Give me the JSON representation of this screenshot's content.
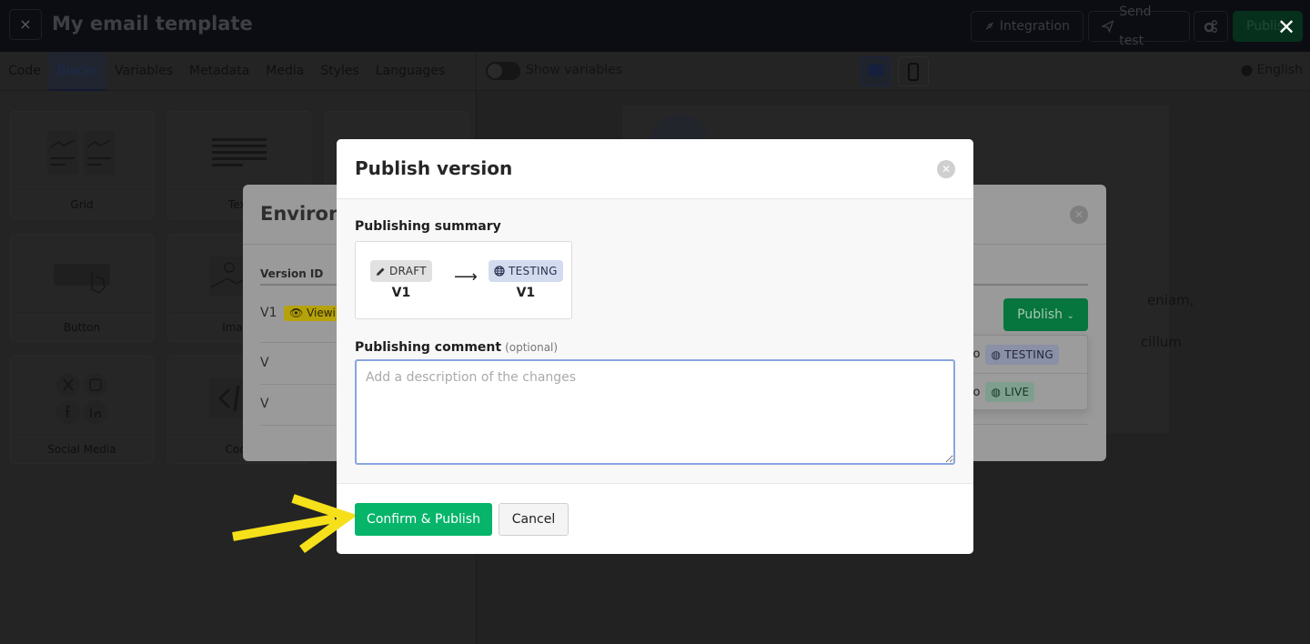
{
  "app": {
    "title": "My email template",
    "close_label": "×",
    "overlay_close_label": "✕"
  },
  "toolbar": {
    "integration_label": "Integration",
    "send_test_label": "Send test",
    "settings_icon": "gears-icon",
    "publish_label": "Publis"
  },
  "editor_tabs": [
    {
      "label": "Code",
      "active": false
    },
    {
      "label": "Blocks",
      "active": true
    },
    {
      "label": "Variables",
      "active": false
    },
    {
      "label": "Metadata",
      "active": false
    },
    {
      "label": "Media",
      "active": false
    },
    {
      "label": "Styles",
      "active": false
    },
    {
      "label": "Languages",
      "active": false
    }
  ],
  "preview_bar": {
    "show_variables_label": "Show variables",
    "show_variables_on": false,
    "device_active": "desktop",
    "language": "English"
  },
  "blocks": [
    {
      "label": "Grid",
      "icon": "grid-block-icon"
    },
    {
      "label": "Text",
      "icon": "text-block-icon"
    },
    {
      "label": "Button",
      "icon": "button-block-icon"
    },
    {
      "label": "Image",
      "icon": "image-block-icon"
    },
    {
      "label": "Social Media",
      "icon": "social-media-block-icon"
    },
    {
      "label": "Code",
      "icon": "code-block-icon"
    }
  ],
  "email_preview": {
    "line1_fragment": "eniam,",
    "line2_fragment": "cillum"
  },
  "environment_modal": {
    "title": "Environments",
    "column_header": "Version ID",
    "rows": [
      {
        "version": "V1",
        "badge": "Viewing"
      },
      {
        "version": "V",
        "badge": ""
      },
      {
        "version": "V",
        "badge": ""
      }
    ],
    "publish_button": "Publish",
    "dropdown": [
      {
        "prefix": "h to",
        "env": "TESTING"
      },
      {
        "prefix": "h to",
        "env": "LIVE"
      }
    ]
  },
  "publish_modal": {
    "title": "Publish version",
    "summary_label": "Publishing summary",
    "from": {
      "status": "DRAFT",
      "version": "V1"
    },
    "to": {
      "status": "TESTING",
      "version": "V1"
    },
    "arrow": "⟶",
    "comment_label": "Publishing comment",
    "comment_optional": "(optional)",
    "comment_placeholder": "Add a description of the changes",
    "comment_value": "",
    "confirm_label": "Confirm & Publish",
    "cancel_label": "Cancel"
  },
  "colors": {
    "confirm_green": "#06b46a",
    "testing_tag": "#d3dbef",
    "draft_tag": "#e1e1e1",
    "annotation_yellow": "#f5e01a"
  }
}
